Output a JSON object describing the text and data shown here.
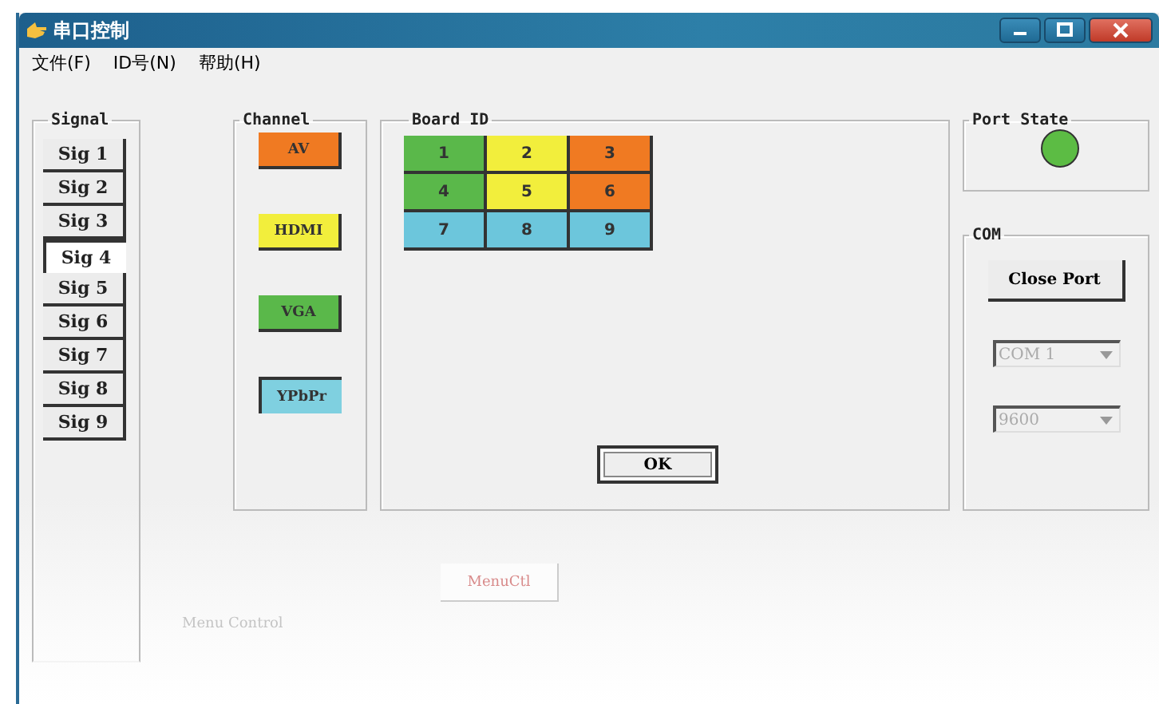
{
  "window": {
    "title": "串口控制"
  },
  "menu": [
    "文件(F)",
    "ID号(N)",
    "帮助(H)"
  ],
  "signal": {
    "title": "Signal",
    "items": [
      {
        "label": "Sig 1",
        "selected": false
      },
      {
        "label": "Sig 2",
        "selected": false
      },
      {
        "label": "Sig 3",
        "selected": false
      },
      {
        "label": "Sig 4",
        "selected": true
      },
      {
        "label": "Sig 5",
        "selected": false
      },
      {
        "label": "Sig 6",
        "selected": false
      },
      {
        "label": "Sig 7",
        "selected": false
      },
      {
        "label": "Sig 8",
        "selected": false
      },
      {
        "label": "Sig 9",
        "selected": false
      }
    ]
  },
  "channel": {
    "title": "Channel",
    "items": [
      {
        "label": "AV",
        "color": "#f07a22",
        "selected": false
      },
      {
        "label": "HDMI",
        "color": "#f2ee3c",
        "selected": false
      },
      {
        "label": "VGA",
        "color": "#5ab84a",
        "selected": false
      },
      {
        "label": "YPbPr",
        "color": "#7fd0e0",
        "selected": true
      }
    ]
  },
  "board_id": {
    "title": "Board ID",
    "cells": [
      {
        "label": "1",
        "color": "#5ab84a"
      },
      {
        "label": "2",
        "color": "#f2ee3c"
      },
      {
        "label": "3",
        "color": "#f07a22"
      },
      {
        "label": "4",
        "color": "#5ab84a"
      },
      {
        "label": "5",
        "color": "#f2ee3c"
      },
      {
        "label": "6",
        "color": "#f07a22"
      },
      {
        "label": "7",
        "color": "#6cc6dc"
      },
      {
        "label": "8",
        "color": "#6cc6dc"
      },
      {
        "label": "9",
        "color": "#6cc6dc"
      }
    ],
    "ok_button": "OK"
  },
  "port_state": {
    "title": "Port State",
    "on": true
  },
  "com": {
    "title": "COM",
    "close_button": "Close Port",
    "port": {
      "value": "COM 1",
      "disabled": true
    },
    "baud": {
      "value": "9600",
      "disabled": true
    }
  },
  "menu_ctl_button": "MenuCtl",
  "menu_control_label": "Menu Control"
}
